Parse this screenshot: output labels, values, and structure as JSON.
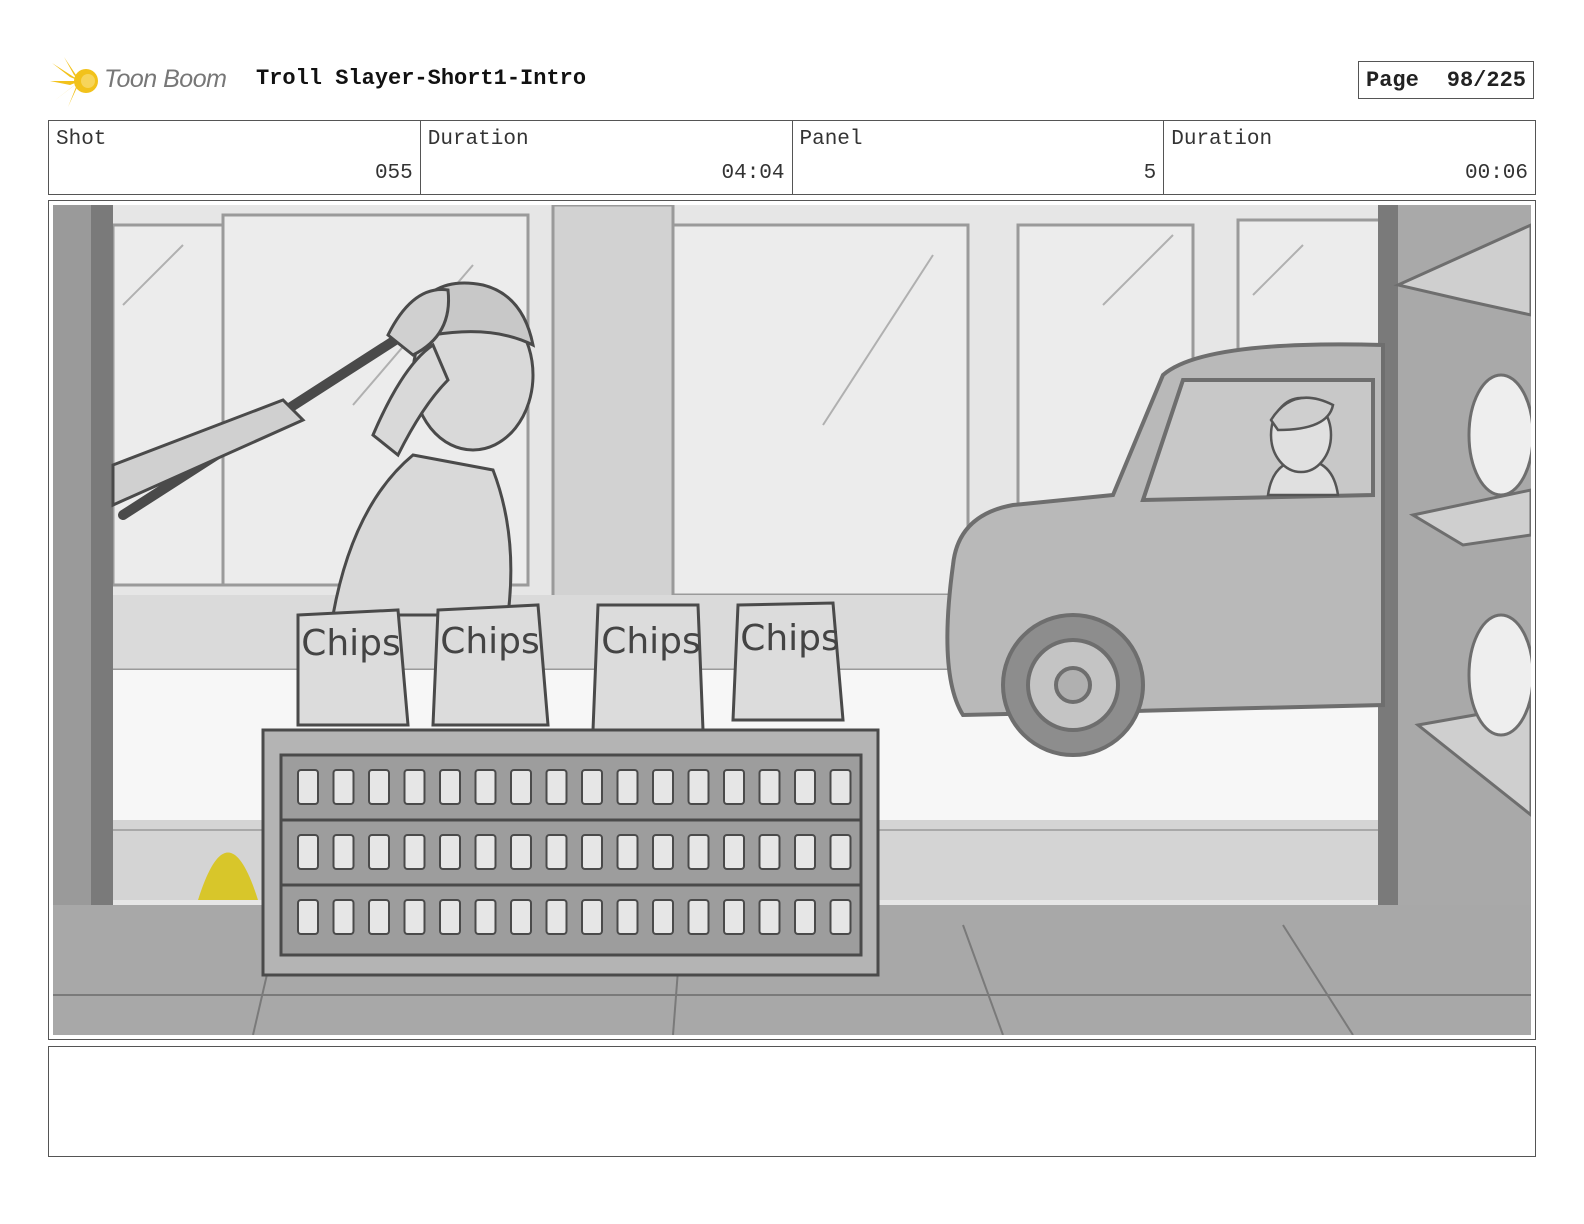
{
  "header": {
    "logo_text": "Toon Boom",
    "project_title": "Troll Slayer-Short1-Intro",
    "page_label": "Page",
    "page_value": "98/225"
  },
  "info": {
    "shot_label": "Shot",
    "shot_value": "055",
    "shot_duration_label": "Duration",
    "shot_duration_value": "04:04",
    "panel_label": "Panel",
    "panel_value": "5",
    "panel_duration_label": "Duration",
    "panel_duration_value": "00:06"
  },
  "panel": {
    "chip_bag_labels": [
      "Chips",
      "Chips",
      "Chips",
      "Chips"
    ]
  },
  "notes": {
    "text": ""
  },
  "colors": {
    "border": "#555555",
    "logo_yellow": "#f2c21b",
    "sketch_gray": "#9a9a9a",
    "accent_yellow": "#d8c62a"
  }
}
